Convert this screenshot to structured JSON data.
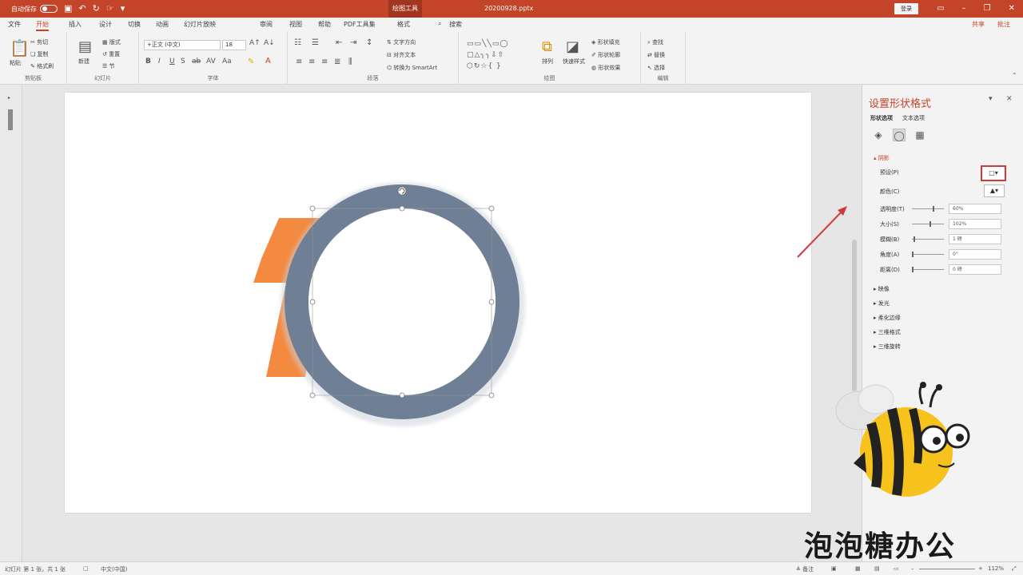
{
  "titlebar": {
    "autosave_label": "自动保存",
    "context_tab": "绘图工具",
    "filename": "20200928.pptx",
    "signin_label": "登录",
    "colors": {
      "accent": "#c4442a"
    }
  },
  "tabs": [
    "文件",
    "开始",
    "插入",
    "设计",
    "切换",
    "动画",
    "幻灯片放映",
    "审阅",
    "视图",
    "帮助",
    "PDF工具集",
    "格式",
    "搜索"
  ],
  "tabs_right": [
    "共享",
    "批注"
  ],
  "ribbon": {
    "clipboard": {
      "paste": "粘贴",
      "cut": "剪切",
      "copy": "复制",
      "format_painter": "格式刷",
      "group": "剪贴板"
    },
    "slides": {
      "new": "新建",
      "layout": "版式",
      "reset": "重置",
      "section": "节",
      "group": "幻灯片"
    },
    "font": {
      "font_name": "+正文 (中文)",
      "font_size": "18",
      "group": "字体"
    },
    "paragraph": {
      "text_direction": "文字方向",
      "align_text": "对齐文本",
      "smartart": "转换为 SmartArt",
      "group": "段落"
    },
    "drawing": {
      "arrange": "排列",
      "quick_styles": "快速样式",
      "shape_fill": "形状填充",
      "shape_outline": "形状轮廓",
      "shape_effects": "形状效果",
      "group": "绘图"
    },
    "editing": {
      "find": "查找",
      "replace": "替换",
      "select": "选择",
      "group": "编辑"
    }
  },
  "pane": {
    "title": "设置形状格式",
    "tab_shape": "形状选项",
    "tab_text": "文本选项",
    "section_open": "阴影",
    "rows": [
      {
        "label": "预设(P)",
        "value": ""
      },
      {
        "label": "颜色(C)",
        "value": ""
      },
      {
        "label": "透明度(T)",
        "value": "60%"
      },
      {
        "label": "大小(S)",
        "value": "102%"
      },
      {
        "label": "模糊(B)",
        "value": "1 磅"
      },
      {
        "label": "角度(A)",
        "value": "0°"
      },
      {
        "label": "距离(D)",
        "value": "0 磅"
      }
    ],
    "collapsed": [
      "映像",
      "发光",
      "柔化边缘",
      "三维格式",
      "三维旋转"
    ]
  },
  "statusbar": {
    "slide_info": "幻灯片 第 1 张，共 1 张",
    "language": "中文(中国)",
    "notes": "备注",
    "zoom": "112%"
  },
  "watermark": "泡泡糖办公",
  "slide": {
    "digit": "1",
    "colors": {
      "ring": "#6f7f95",
      "digit": "#f48a40"
    }
  }
}
